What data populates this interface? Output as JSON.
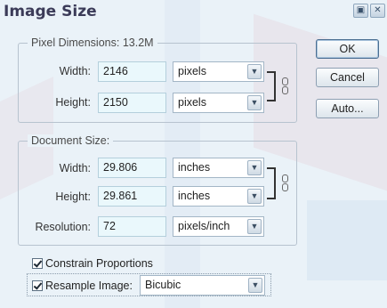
{
  "window": {
    "title": "Image Size"
  },
  "pixel_dimensions": {
    "legend": "Pixel Dimensions:",
    "size": "13.2M",
    "width_label": "Width:",
    "width_value": "2146",
    "width_unit": "pixels",
    "height_label": "Height:",
    "height_value": "2150",
    "height_unit": "pixels"
  },
  "document_size": {
    "legend": "Document Size:",
    "width_label": "Width:",
    "width_value": "29.806",
    "width_unit": "inches",
    "height_label": "Height:",
    "height_value": "29.861",
    "height_unit": "inches",
    "resolution_label": "Resolution:",
    "resolution_value": "72",
    "resolution_unit": "pixels/inch"
  },
  "options": {
    "constrain_label": "Constrain Proportions",
    "constrain_checked": true,
    "resample_label": "Resample Image:",
    "resample_checked": true,
    "resample_method": "Bicubic"
  },
  "buttons": {
    "ok": "OK",
    "cancel": "Cancel",
    "auto": "Auto..."
  },
  "icons": {
    "dropdown": "chevron-down-icon",
    "link": "chain-link-icon",
    "check": "check-icon"
  },
  "colors": {
    "title": "#3b3b58",
    "field_bg": "#eaf8fc",
    "dialog_bg": "#eaf2f8"
  }
}
